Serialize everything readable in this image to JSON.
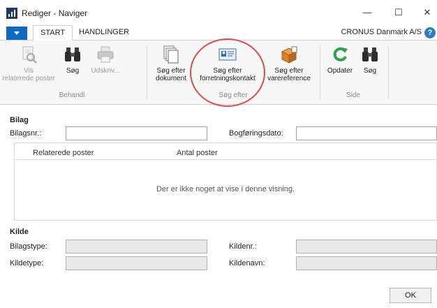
{
  "window": {
    "title": "Rediger - Naviger",
    "minimize": "—",
    "maximize": "☐",
    "close": "✕"
  },
  "ribbon_tabs": {
    "tabs": [
      {
        "label": "START"
      },
      {
        "label": "HANDLINGER"
      }
    ],
    "company": "CRONUS Danmark A/S",
    "help": "?"
  },
  "ribbon": {
    "groups": [
      {
        "label": "Behandl",
        "buttons": [
          {
            "label_line1": "Vis",
            "label_line2": "relaterede poster",
            "icon": "view-related-icon",
            "enabled": false
          },
          {
            "label_line1": "Søg",
            "label_line2": "",
            "icon": "binoculars-icon",
            "enabled": true
          },
          {
            "label_line1": "Udskriv...",
            "label_line2": "",
            "icon": "printer-icon",
            "enabled": false
          }
        ]
      },
      {
        "label": "Søg efter",
        "buttons": [
          {
            "label_line1": "Søg efter",
            "label_line2": "dokument",
            "icon": "documents-icon",
            "enabled": true
          },
          {
            "label_line1": "Søg efter",
            "label_line2": "forretningskontakt",
            "icon": "contact-card-icon",
            "enabled": true
          },
          {
            "label_line1": "Søg efter",
            "label_line2": "varereference",
            "icon": "item-box-icon",
            "enabled": true
          }
        ]
      },
      {
        "label": "Side",
        "buttons": [
          {
            "label_line1": "Opdater",
            "label_line2": "",
            "icon": "refresh-icon",
            "enabled": true
          },
          {
            "label_line1": "Søg",
            "label_line2": "",
            "icon": "binoculars-icon",
            "enabled": true
          }
        ]
      }
    ]
  },
  "bilag": {
    "title": "Bilag",
    "bilagsnr_label": "Bilagsnr.:",
    "bilagsnr_value": "",
    "bogforingsdato_label": "Bogføringsdato:",
    "bogforingsdato_value": ""
  },
  "grid": {
    "columns": [
      "Relaterede poster",
      "Antal poster"
    ],
    "empty_message": "Der er ikke noget at vise i denne visning."
  },
  "kilde": {
    "title": "Kilde",
    "bilagstype_label": "Bilagstype:",
    "kildenr_label": "Kildenr.:",
    "kildetype_label": "Kildetype:",
    "kildenavn_label": "Kildenavn:"
  },
  "actions": {
    "ok": "OK"
  },
  "colors": {
    "accent": "#0a6ac2",
    "highlight": "#e04a4a",
    "refresh_green": "#2aa34a",
    "box_orange": "#d9822b"
  }
}
